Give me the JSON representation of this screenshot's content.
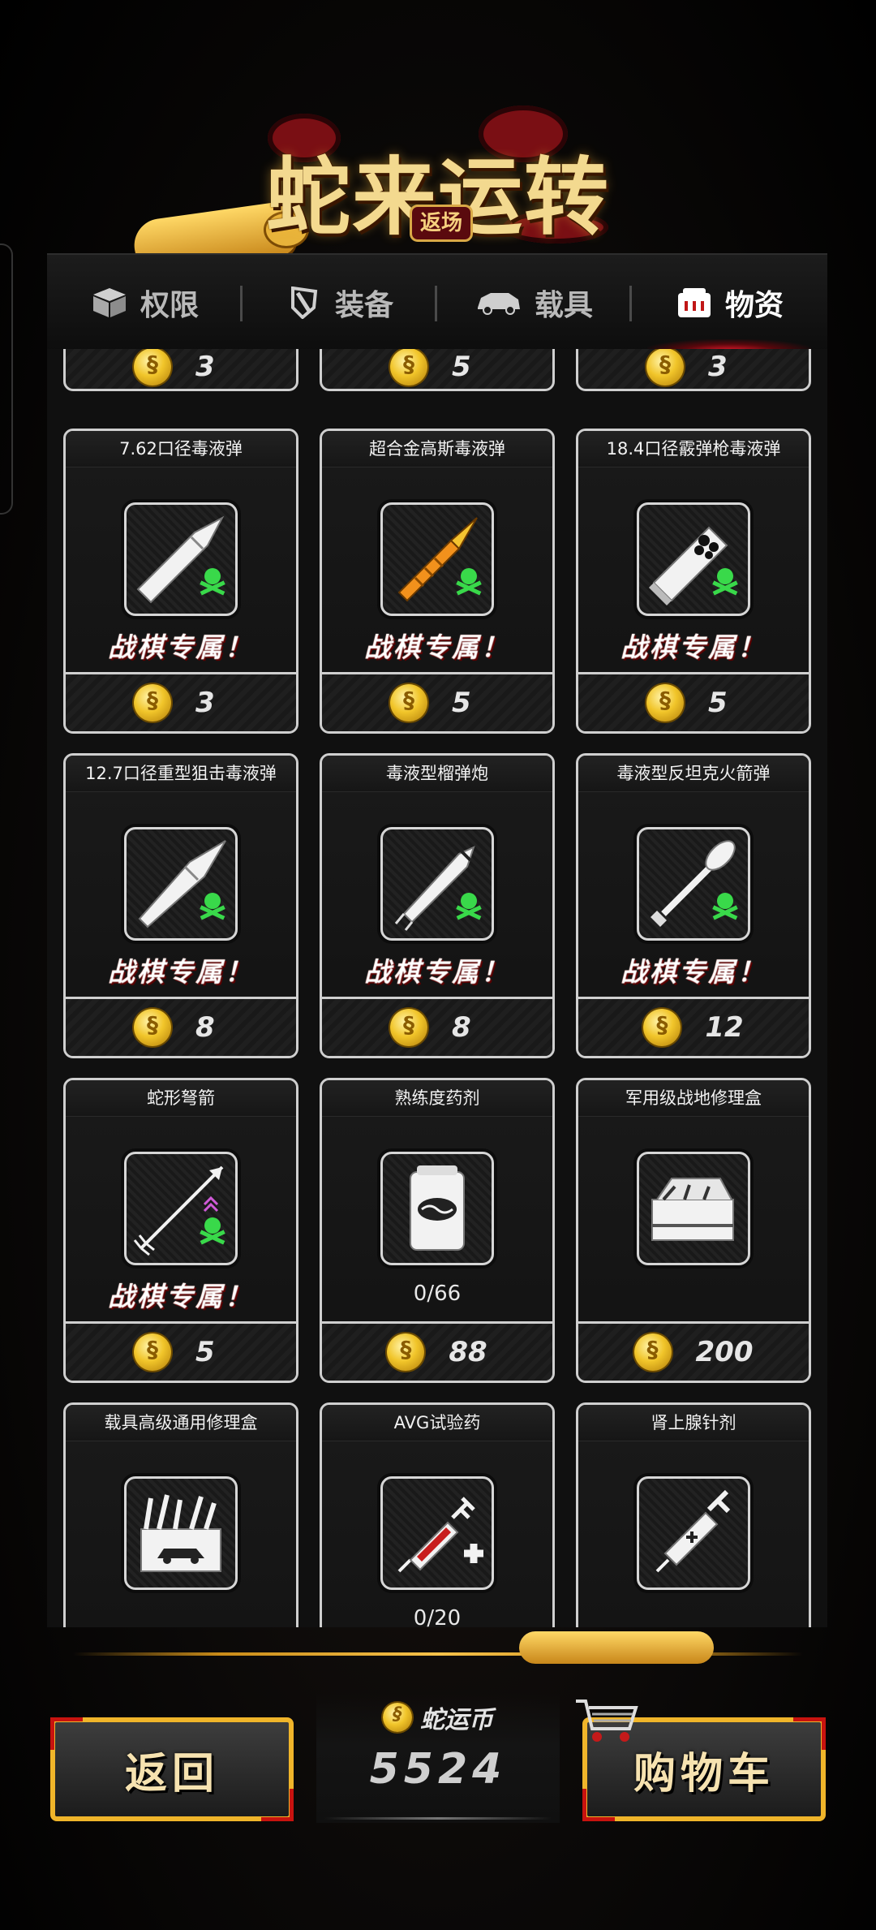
{
  "header": {
    "title": "蛇来运转",
    "subtitle": "返场"
  },
  "tabs": [
    {
      "label": "权限",
      "icon": "box-icon",
      "active": false
    },
    {
      "label": "装备",
      "icon": "shield-icon",
      "active": false
    },
    {
      "label": "载具",
      "icon": "car-icon",
      "active": false
    },
    {
      "label": "物资",
      "icon": "shop-icon",
      "active": true
    }
  ],
  "top_partial_prices": [
    "3",
    "5",
    "3"
  ],
  "items": [
    {
      "title": "7.62口径毒液弹",
      "icon": "rifle-bullet-icon",
      "tag": "战棋专属！",
      "price": "3"
    },
    {
      "title": "超合金高斯毒液弹",
      "icon": "gauss-bullet-icon",
      "tag": "战棋专属！",
      "price": "5"
    },
    {
      "title": "18.4口径霰弹枪毒液弹",
      "icon": "shotgun-shell-icon",
      "tag": "战棋专属！",
      "price": "5"
    },
    {
      "title": "12.7口径重型狙击毒液弹",
      "icon": "sniper-bullet-icon",
      "tag": "战棋专属！",
      "price": "8"
    },
    {
      "title": "毒液型榴弹炮",
      "icon": "grenade-shell-icon",
      "tag": "战棋专属！",
      "price": "8"
    },
    {
      "title": "毒液型反坦克火箭弹",
      "icon": "rocket-icon",
      "tag": "战棋专属！",
      "price": "12"
    },
    {
      "title": "蛇形弩箭",
      "icon": "arrow-icon",
      "tag": "战棋专属！",
      "price": "5"
    },
    {
      "title": "熟练度药剂",
      "icon": "potion-can-icon",
      "progress": "0/66",
      "price": "88"
    },
    {
      "title": "军用级战地修理盒",
      "icon": "toolbox-icon",
      "price": "200"
    },
    {
      "title": "载具高级通用修理盒",
      "icon": "vehicle-toolbox-icon"
    },
    {
      "title": "AVG试验药",
      "icon": "syringe-plus-icon",
      "progress": "0/20"
    },
    {
      "title": "肾上腺针剂",
      "icon": "injector-icon"
    }
  ],
  "currency": {
    "label": "蛇运币",
    "value": "5524"
  },
  "buttons": {
    "back": "返回",
    "cart": "购物车"
  },
  "colors": {
    "accent_gold": "#f0b52a",
    "exclusive_red": "#ff4a38",
    "poison_green": "#37d64a",
    "active_tab_glow": "#e0192a"
  }
}
